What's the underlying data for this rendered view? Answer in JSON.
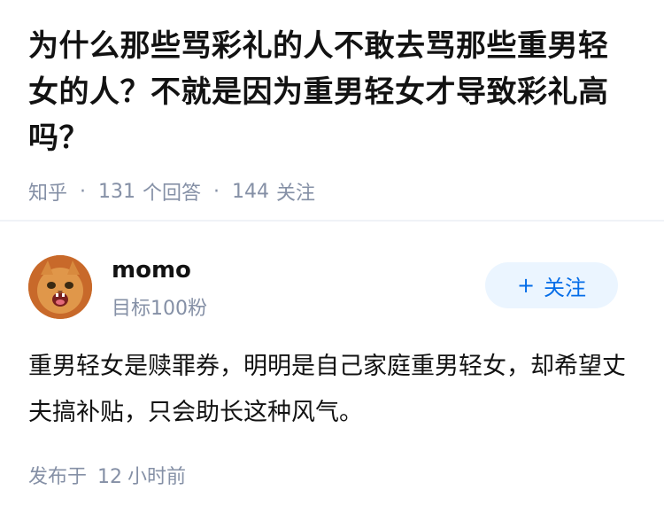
{
  "question": {
    "title": "为什么那些骂彩礼的人不敢去骂那些重男轻女的人？不就是因为重男轻女才导致彩礼高吗？",
    "source": "知乎",
    "separator": "·",
    "answers_count": "131",
    "answers_label": "个回答",
    "followers_count": "144",
    "followers_label": "关注"
  },
  "answer": {
    "author": {
      "name": "momo",
      "headline": "目标100粉",
      "avatar_icon": "cat-avatar-icon"
    },
    "follow_button": {
      "plus": "+",
      "label": "关注"
    },
    "content": "重男轻女是赎罪券，明明是自己家庭重男轻女，却希望丈夫搞补贴，只会助长这种风气。",
    "published": {
      "prefix": "发布于",
      "number": "12",
      "unit": "小时前"
    }
  },
  "colors": {
    "meta_gray": "#8590a6",
    "accent_blue": "#056de8",
    "follow_bg": "#ebf5ff",
    "text": "#121212"
  }
}
